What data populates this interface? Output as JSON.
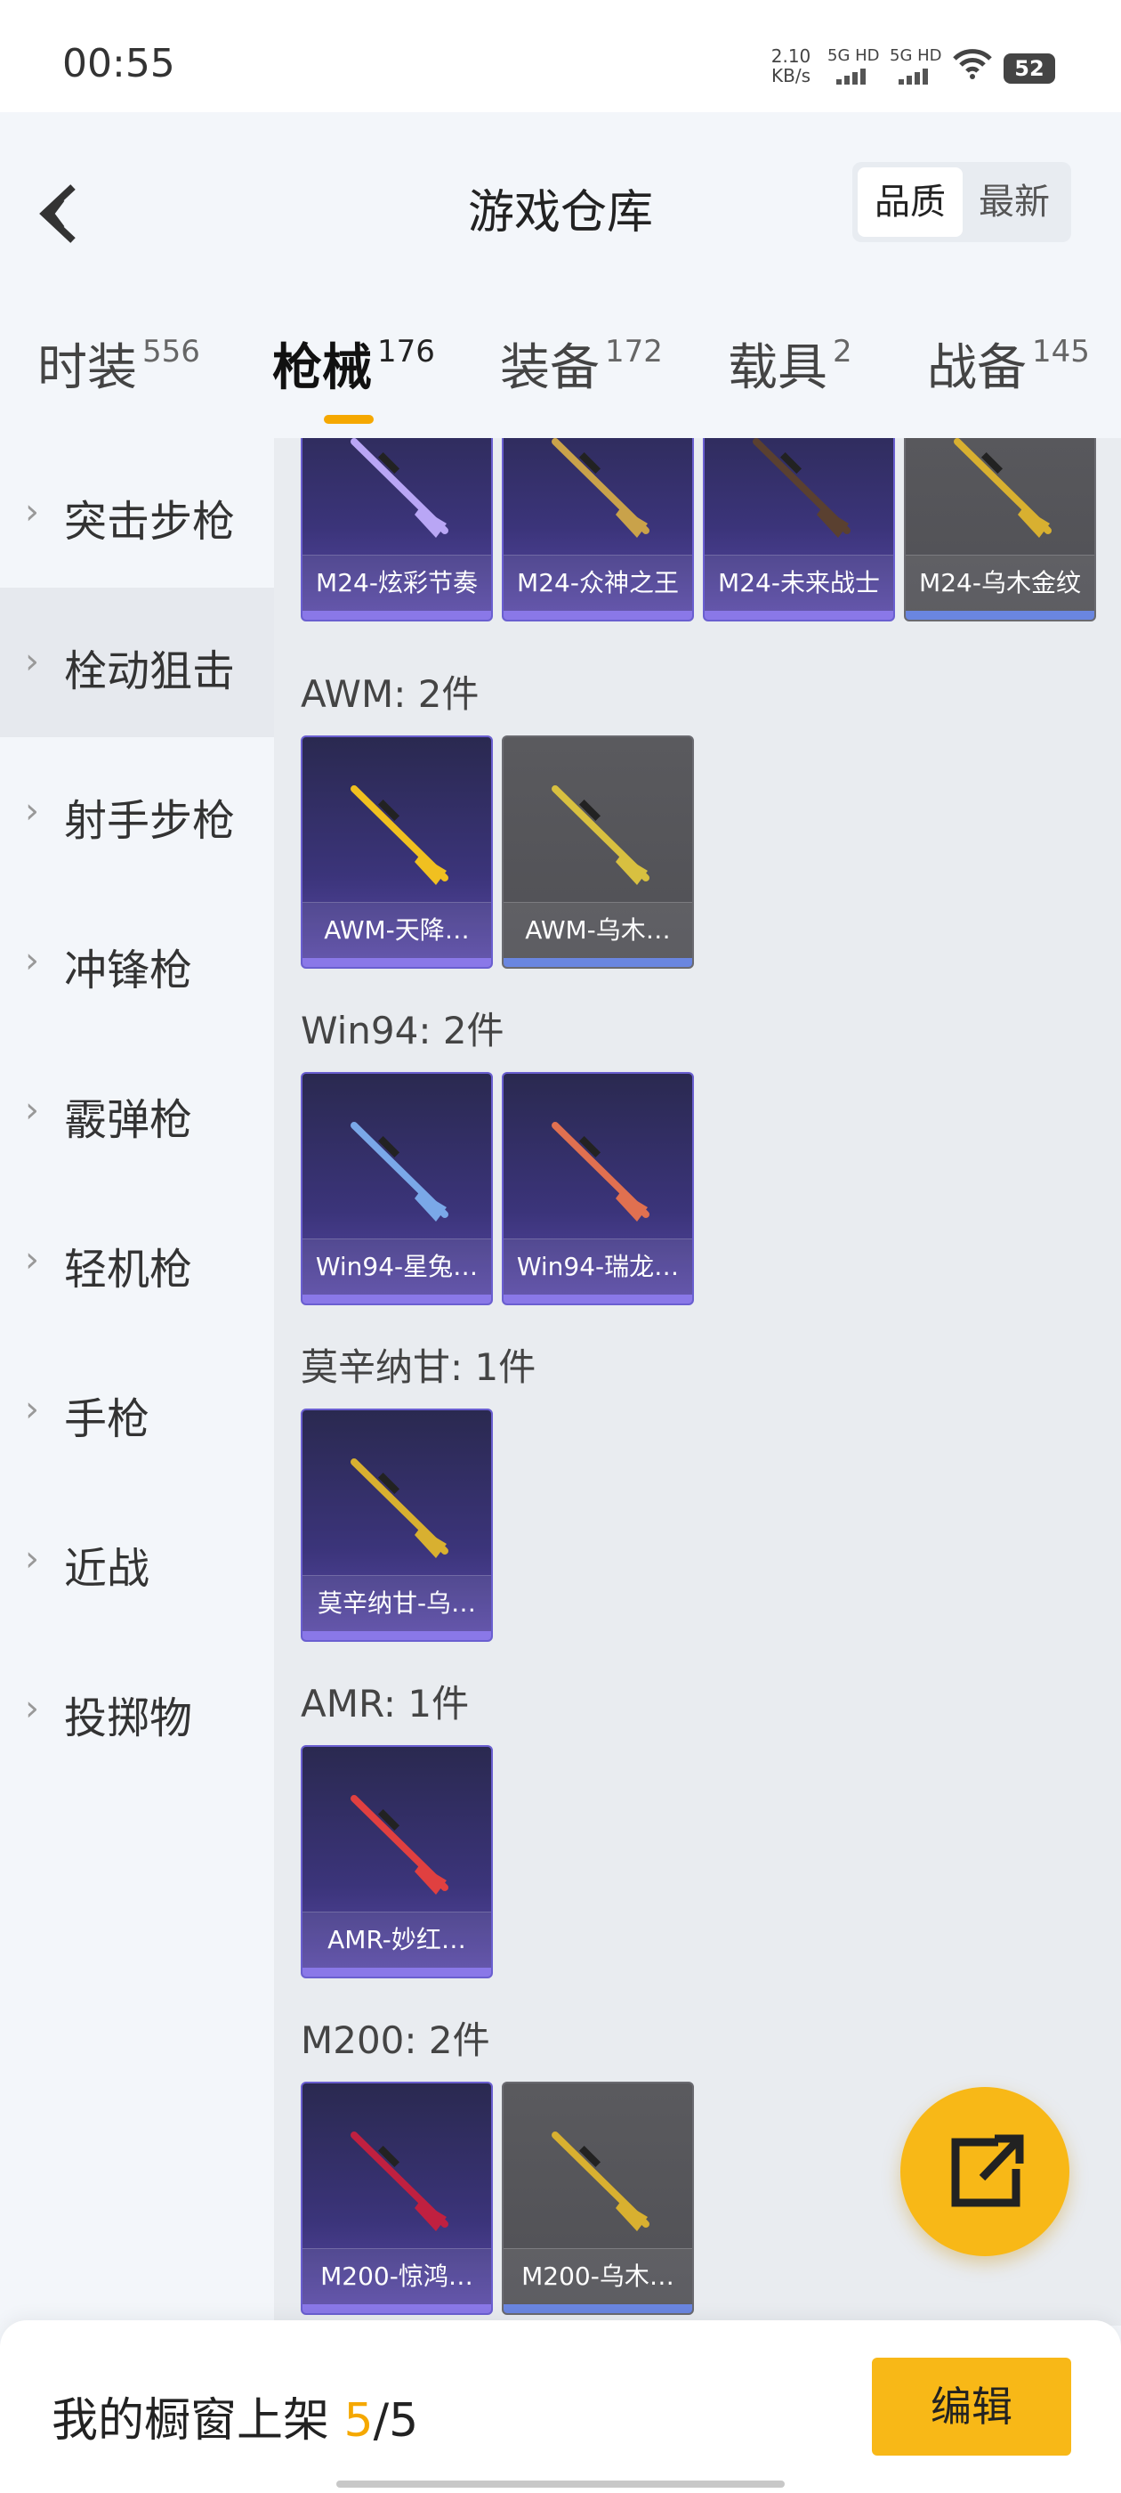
{
  "status": {
    "time": "00:55",
    "net_speed": "2.10",
    "net_unit": "KB/s",
    "sig1": "5G HD",
    "sig2": "5G HD",
    "battery": "52"
  },
  "header": {
    "title": "游戏仓库",
    "sort": [
      "品质",
      "最新"
    ]
  },
  "tabs": [
    {
      "label": "时装",
      "count": "556"
    },
    {
      "label": "枪械",
      "count": "176"
    },
    {
      "label": "装备",
      "count": "172"
    },
    {
      "label": "载具",
      "count": "2"
    },
    {
      "label": "战备",
      "count": "145"
    }
  ],
  "sidebar": [
    "突击步枪",
    "栓动狙击",
    "射手步枪",
    "冲锋枪",
    "霰弹枪",
    "轻机枪",
    "手枪",
    "近战",
    "投掷物"
  ],
  "groups": [
    {
      "title": "",
      "items": [
        {
          "name": "M24-炫彩节奏",
          "rarity": "purple"
        },
        {
          "name": "M24-众神之王",
          "rarity": "purple"
        },
        {
          "name": "M24-未来战士",
          "rarity": "purple"
        },
        {
          "name": "M24-乌木金纹",
          "rarity": "gray"
        }
      ]
    },
    {
      "title": "AWM: 2件",
      "items": [
        {
          "name": "AWM-天降…",
          "rarity": "purple"
        },
        {
          "name": "AWM-乌木…",
          "rarity": "gray"
        }
      ]
    },
    {
      "title": "Win94: 2件",
      "items": [
        {
          "name": "Win94-星兔…",
          "rarity": "purple"
        },
        {
          "name": "Win94-瑞龙…",
          "rarity": "purple"
        }
      ]
    },
    {
      "title": "莫辛纳甘: 1件",
      "items": [
        {
          "name": "莫辛纳甘-乌…",
          "rarity": "purple"
        }
      ]
    },
    {
      "title": "AMR: 1件",
      "items": [
        {
          "name": "AMR-妙红…",
          "rarity": "purple"
        }
      ]
    },
    {
      "title": "M200: 2件",
      "items": [
        {
          "name": "M200-惊鸿…",
          "rarity": "purple"
        },
        {
          "name": "M200-乌木…",
          "rarity": "gray"
        }
      ]
    }
  ],
  "bottom": {
    "label": "我的橱窗上架 ",
    "count": "5",
    "sep": "/",
    "total": "5",
    "edit": "编辑"
  },
  "colors": {
    "accent": "#f8b817",
    "purple": "#3b347a",
    "gray": "#55555a"
  },
  "icons": {
    "back": "back-chevron-icon",
    "share": "share-icon",
    "wifi": "wifi-icon"
  }
}
